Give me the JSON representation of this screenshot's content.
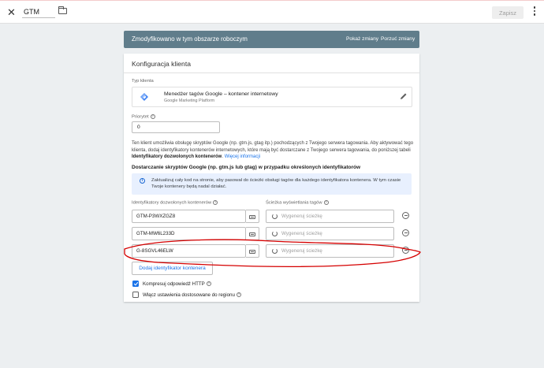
{
  "topbar": {
    "name": "GTM",
    "save_label": "Zapisz"
  },
  "banner": {
    "text": "Zmodyfikowano w tym obszarze roboczym",
    "show_changes": "Pokaż zmiany",
    "discard_changes": "Porzuć zmiany"
  },
  "card": {
    "title": "Konfiguracja klienta",
    "type_label": "Typ klienta",
    "type_name": "Menedżer tagów Google – kontener internetowy",
    "type_sub": "Google Marketing Platform",
    "priority_label": "Priorytet",
    "priority_value": "0",
    "desc_1": "Ten klient umożliwia obsługę skryptów Google (np. gtm.js, gtag itp.) pochodzących z Twojego serwera tagowania. Aby aktywować tego klienta, dodaj identyfikatory kontenerów internetowych, które mają być dostarczane z Twojego serwera tagowania, do poniższej tabeli ",
    "desc_bold": "Identyfikatory dozwolonych kontenerów",
    "desc_2": ". ",
    "desc_link": "Więcej informacji",
    "section_title": "Dostarczanie skryptów Google (np. gtm.js lub gtag) w przypadku określonych identyfikatorów",
    "info_text": "Zaktualizuj cały kod na stronie, aby pasował do ścieżki obsługi tagów dla każdego identyfikatora kontenera. W tym czasie Twoje kontenery będą nadal działać.",
    "ids_label": "Identyfikatory dozwolonych kontenerów",
    "path_label": "Ścieżka wyświetlania tagów",
    "rows": [
      {
        "id": "GTM-P3WXZGZ8",
        "path_placeholder": "Wygeneruj ścieżkę"
      },
      {
        "id": "GTM-MW6L233D",
        "path_placeholder": "Wygeneruj ścieżkę"
      },
      {
        "id": "G-8SGVL46ELW",
        "path_placeholder": "Wygeneruj ścieżkę"
      }
    ],
    "add_label": "Dodaj identyfikator kontenera",
    "compress_label": "Kompresuj odpowiedź HTTP",
    "compress_checked": true,
    "region_label": "Włącz ustawienia dostosowane do regionu",
    "region_checked": false
  },
  "colors": {
    "banner": "#607d8b",
    "accent": "#1a73e8",
    "annotation": "#d50000"
  }
}
